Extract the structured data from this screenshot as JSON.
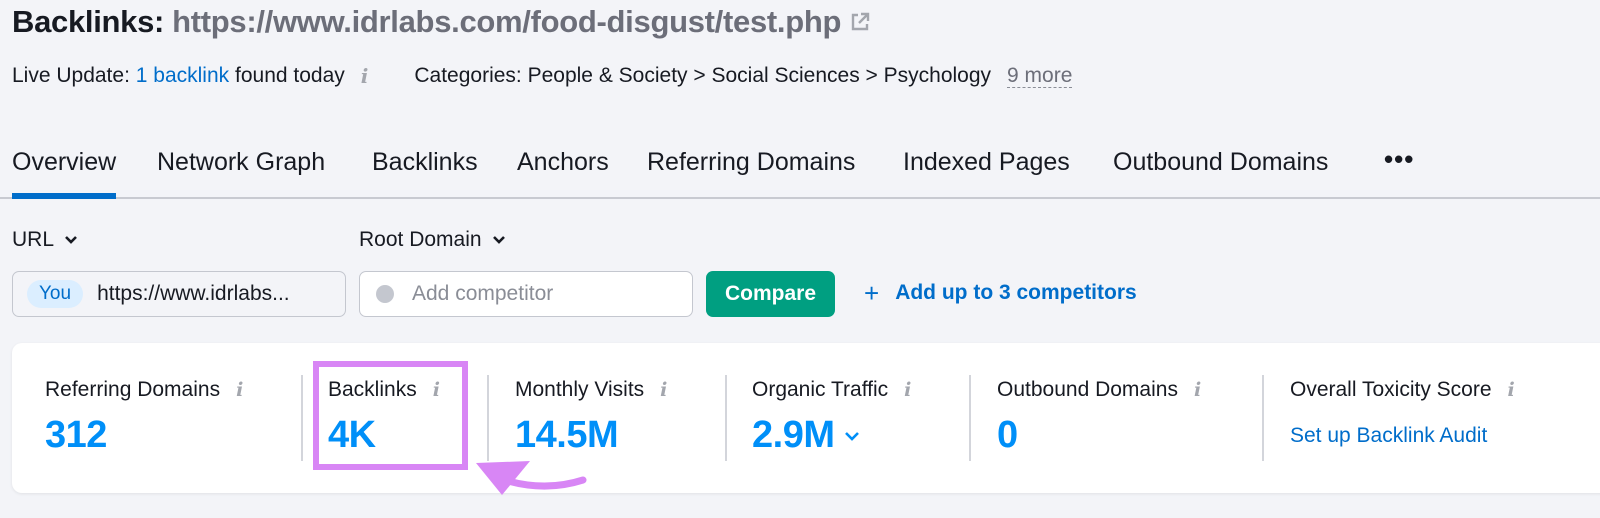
{
  "header": {
    "title_label": "Backlinks:",
    "title_url": "https://www.idrlabs.com/food-disgust/test.php",
    "external_link_icon": "external-link-icon",
    "live_update_prefix": "Live Update:",
    "live_update_link": "1 backlink",
    "live_update_suffix": "found today",
    "info_glyph": "i",
    "categories": "Categories: People & Society > Social Sciences > Psychology",
    "more_categories": "9 more"
  },
  "tabs": [
    {
      "label": "Overview",
      "active": true
    },
    {
      "label": "Network Graph",
      "active": false
    },
    {
      "label": "Backlinks",
      "active": false
    },
    {
      "label": "Anchors",
      "active": false
    },
    {
      "label": "Referring Domains",
      "active": false
    },
    {
      "label": "Indexed Pages",
      "active": false
    },
    {
      "label": "Outbound Domains",
      "active": false
    }
  ],
  "tabs_more": "•••",
  "filters": {
    "scope_selector": "URL",
    "domain_selector": "Root Domain",
    "you_badge": "You",
    "you_url": "https://www.idrlabs...",
    "competitor_placeholder": "Add competitor",
    "compare_button": "Compare",
    "add_competitors_plus": "+",
    "add_competitors_link": "Add up to 3 competitors"
  },
  "metrics": [
    {
      "label": "Referring Domains",
      "value": "312"
    },
    {
      "label": "Backlinks",
      "value": "4K",
      "highlighted": true
    },
    {
      "label": "Monthly Visits",
      "value": "14.5M"
    },
    {
      "label": "Organic Traffic",
      "value": "2.9M",
      "has_dropdown": true
    },
    {
      "label": "Outbound Domains",
      "value": "0"
    },
    {
      "label": "Overall Toxicity Score",
      "link": "Set up Backlink Audit"
    }
  ],
  "colors": {
    "accent_blue": "#006dca",
    "metric_blue": "#008ff8",
    "compare_green": "#009f81",
    "annotation_purple": "#d886f5",
    "background": "#f3f4f8"
  }
}
